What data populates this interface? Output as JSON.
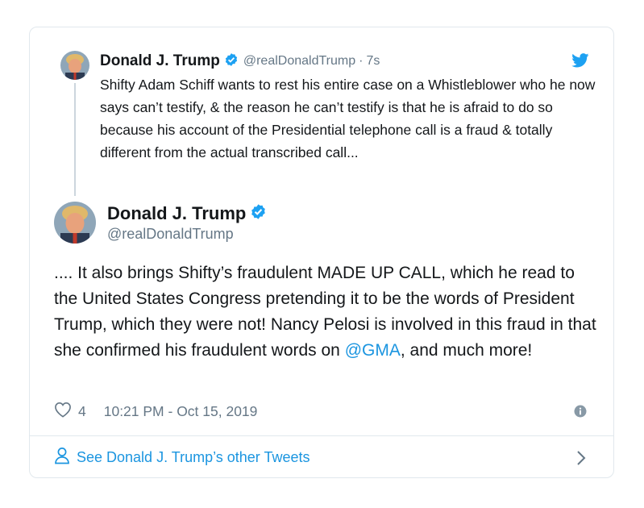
{
  "parent_tweet": {
    "name": "Donald J. Trump",
    "handle": "@realDonaldTrump",
    "separator": "·",
    "time": "7s",
    "text": "Shifty Adam Schiff wants to rest his entire case on a Whistleblower who he now says can’t testify, & the reason he can’t testify is that he is afraid to do so because his account of the Presidential telephone call is a fraud & totally different from the actual transcribed call..."
  },
  "main_tweet": {
    "name": "Donald J. Trump",
    "handle": "@realDonaldTrump",
    "text_before": ".... It also brings Shifty’s fraudulent MADE UP CALL, which he read to the United States Congress pretending it to be the words of President Trump, which they were not! Nancy Pelosi is involved in this fraud in that she confirmed his fraudulent words on ",
    "mention": "@GMA",
    "text_after": ", and much more!",
    "likes": "4",
    "timestamp": "10:21 PM - Oct 15, 2019"
  },
  "footer": {
    "label": "See Donald J. Trump’s other Tweets"
  },
  "icons": {
    "verified": "verified-badge-icon",
    "brand": "twitter-bird-icon",
    "like": "heart-icon",
    "info": "info-icon",
    "person": "person-icon",
    "chevron": "chevron-right-icon"
  },
  "colors": {
    "accent": "#1da1f2",
    "link": "#1b95e0",
    "muted": "#657786",
    "border": "#e1e8ed"
  }
}
